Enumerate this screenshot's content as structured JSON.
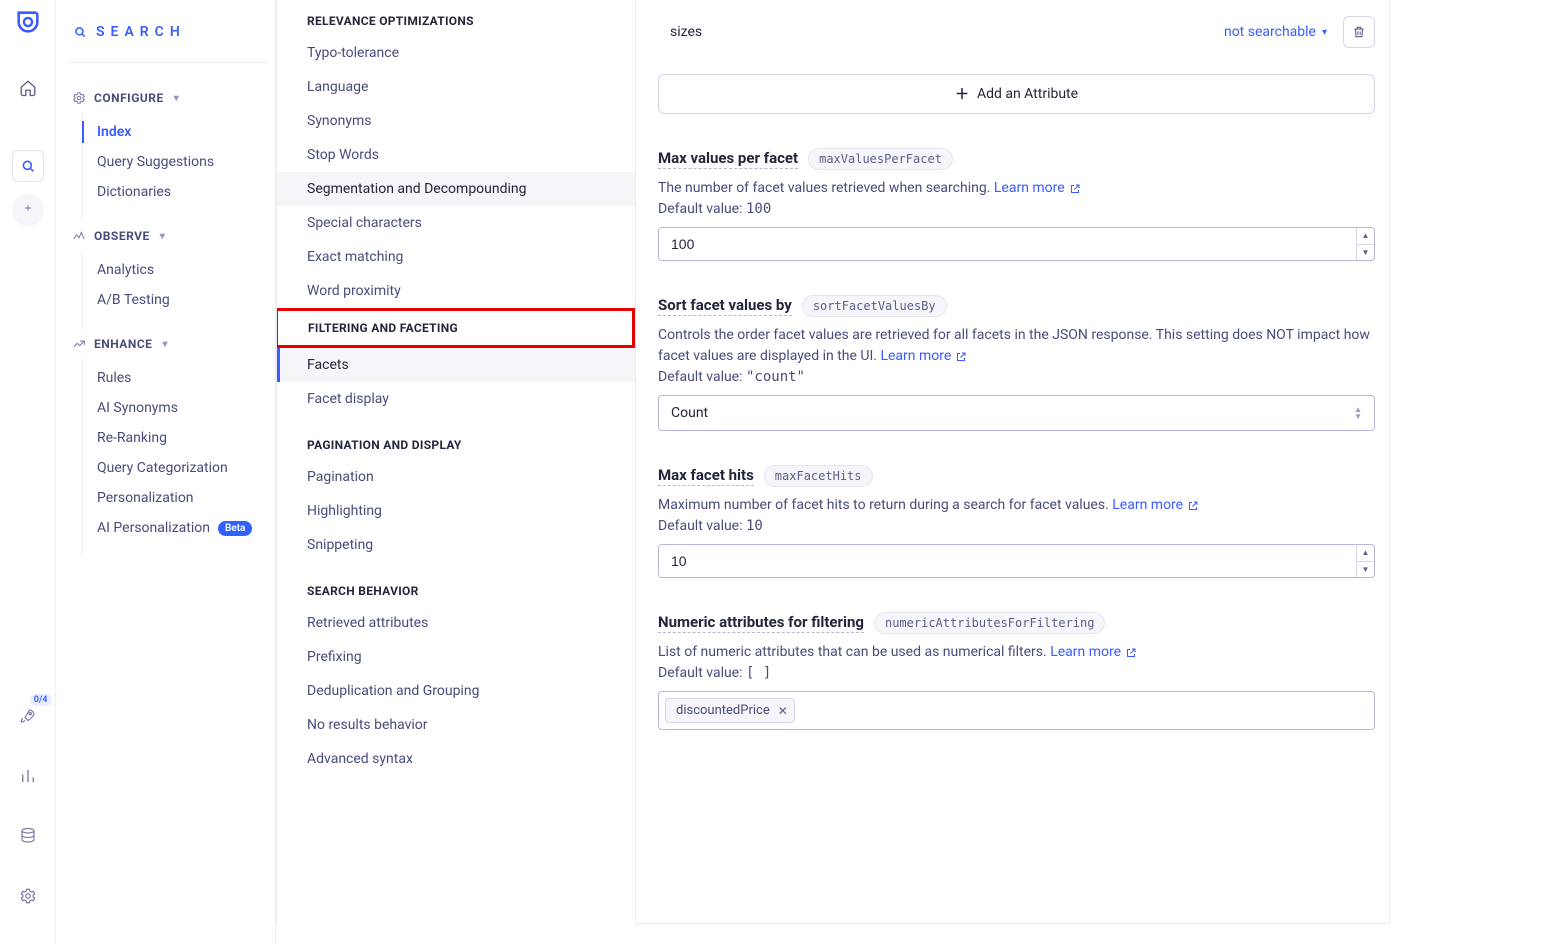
{
  "rail": {
    "rocket_badge": "0/4"
  },
  "sidebar": {
    "title": "SEARCH",
    "groups": {
      "configure": {
        "label": "CONFIGURE",
        "items": [
          {
            "label": "Index",
            "active": true
          },
          {
            "label": "Query Suggestions"
          },
          {
            "label": "Dictionaries"
          }
        ]
      },
      "observe": {
        "label": "OBSERVE",
        "items": [
          {
            "label": "Analytics"
          },
          {
            "label": "A/B Testing"
          }
        ]
      },
      "enhance": {
        "label": "ENHANCE",
        "items": [
          {
            "label": "Rules"
          },
          {
            "label": "AI Synonyms"
          },
          {
            "label": "Re-Ranking"
          },
          {
            "label": "Query Categorization"
          },
          {
            "label": "Personalization"
          },
          {
            "label": "AI Personalization",
            "badge": "Beta"
          }
        ]
      }
    }
  },
  "settings_nav": {
    "sections": [
      {
        "header": "RELEVANCE OPTIMIZATIONS",
        "items": [
          "Typo-tolerance",
          "Language",
          "Synonyms",
          "Stop Words",
          "Segmentation and Decompounding",
          "Special characters",
          "Exact matching",
          "Word proximity"
        ]
      },
      {
        "header": "FILTERING AND FACETING",
        "highlight": true,
        "items": [
          "Facets",
          "Facet display"
        ],
        "active": "Facets"
      },
      {
        "header": "PAGINATION AND DISPLAY",
        "items": [
          "Pagination",
          "Highlighting",
          "Snippeting"
        ]
      },
      {
        "header": "SEARCH BEHAVIOR",
        "items": [
          "Retrieved attributes",
          "Prefixing",
          "Deduplication and Grouping",
          "No results behavior",
          "Advanced syntax"
        ]
      }
    ]
  },
  "attributes": {
    "row_label": "sizes",
    "searchable_select": "not searchable",
    "add_button": "Add an Attribute"
  },
  "maxValuesPerFacet": {
    "title": "Max values per facet",
    "api": "maxValuesPerFacet",
    "desc": "The number of facet values retrieved when searching.",
    "learn_more": "Learn more",
    "default_prefix": "Default value: ",
    "default": "100",
    "value": "100"
  },
  "sortFacetValuesBy": {
    "title": "Sort facet values by",
    "api": "sortFacetValuesBy",
    "desc": "Controls the order facet values are retrieved for all facets in the JSON response. This setting does NOT impact how facet values are displayed in the UI.",
    "learn_more": "Learn more",
    "default_prefix": "Default value: ",
    "default": "\"count\"",
    "value": "Count"
  },
  "maxFacetHits": {
    "title": "Max facet hits",
    "api": "maxFacetHits",
    "desc": "Maximum number of facet hits to return during a search for facet values.",
    "learn_more": "Learn more",
    "default_prefix": "Default value: ",
    "default": "10",
    "value": "10"
  },
  "numericAttributesForFiltering": {
    "title": "Numeric attributes for filtering",
    "api": "numericAttributesForFiltering",
    "desc": "List of numeric attributes that can be used as numerical filters.",
    "learn_more": "Learn more",
    "default_prefix": "Default value: ",
    "default": "[ ]",
    "tags": [
      "discountedPrice"
    ]
  }
}
